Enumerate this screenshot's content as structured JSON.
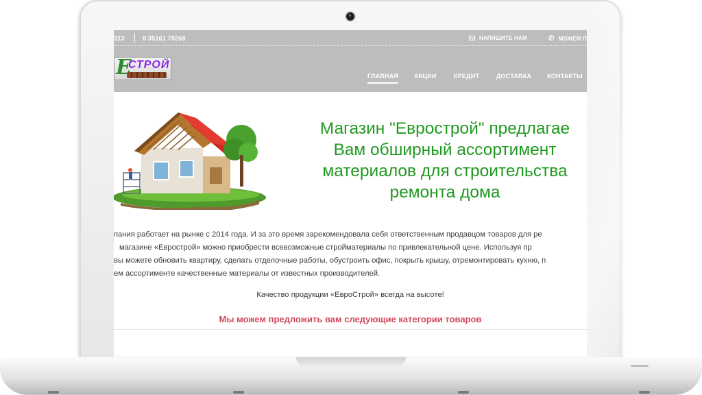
{
  "topbar": {
    "phone1": "313",
    "phone2": "8 35161 79268",
    "write_us": "НАПИШИТЕ НАМ",
    "call_us": "МОЖЕМ П"
  },
  "logo": {
    "letter": "Е",
    "text": "СТРОЙ"
  },
  "nav": {
    "items": [
      {
        "label": "ГЛАВНАЯ",
        "active": true
      },
      {
        "label": "АКЦИИ"
      },
      {
        "label": "КРЕДИТ"
      },
      {
        "label": "ДОСТАВКА"
      },
      {
        "label": "КОНТАКТЫ"
      }
    ]
  },
  "hero": {
    "lines": [
      "Магазин \"Евро­строй\" предлагае",
      "Вам обширный ассортимент",
      "материалов для строительства",
      "ремонта дома"
    ]
  },
  "content": {
    "paragraph_lines": [
      "пания работает на рынке с 2014 года. И за это время зарекомендовала себя ответственным продавцом товаров для ре",
      "магазине «Еврострой» можно приобрести всевозможные стройматериалы по привлекательной цене. Используя пр",
      "вы можете обновить квартиру, сделать отделочные работы, обустроить офис, покрыть крышу, отремонтировать кухню, п",
      "ем ассортименте качественные материалы от известных производителей."
    ],
    "quality": "Качество продукции «ЕвроСтрой» всегда на высоте!",
    "categories_heading": "Мы можем предложить вам следующие категории товаров"
  },
  "colors": {
    "header_bg": "#bdbdbd",
    "hero_green": "#1f9a1f",
    "categories_red": "#d14a5a"
  }
}
